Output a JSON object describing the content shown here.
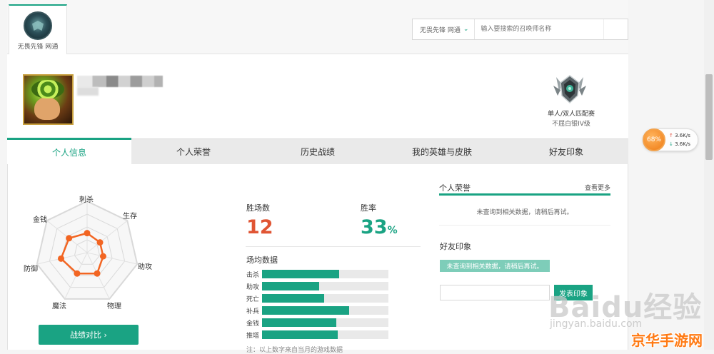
{
  "server": {
    "tab_label": "无畏先锋 网通",
    "select_label": "无畏先锋 网通"
  },
  "search": {
    "placeholder": "输入要搜索的召唤师名称"
  },
  "rank": {
    "queue": "单人/双人匹配赛",
    "tier": "不屈白银IV级"
  },
  "tabs": [
    {
      "label": "个人信息",
      "active": true
    },
    {
      "label": "个人荣誉",
      "active": false
    },
    {
      "label": "历史战绩",
      "active": false
    },
    {
      "label": "我的英雄与皮肤",
      "active": false
    },
    {
      "label": "好友印象",
      "active": false
    }
  ],
  "radar": {
    "axes": [
      "刺杀",
      "生存",
      "助攻",
      "物理",
      "魔法",
      "防御",
      "金钱"
    ],
    "values": [
      0.38,
      0.32,
      0.32,
      0.45,
      0.45,
      0.52,
      0.45
    ]
  },
  "compare_button": "战绩对比 ›",
  "stats": {
    "wins_label": "胜场数",
    "wins_value": "12",
    "winrate_label": "胜率",
    "winrate_value": "33",
    "winrate_unit": "%"
  },
  "avg": {
    "title": "场均数据",
    "rows": [
      {
        "label": "击杀",
        "fraction": 0.61
      },
      {
        "label": "助攻",
        "fraction": 0.45
      },
      {
        "label": "死亡",
        "fraction": 0.49
      },
      {
        "label": "补兵",
        "fraction": 0.69
      },
      {
        "label": "金钱",
        "fraction": 0.59
      },
      {
        "label": "推塔",
        "fraction": 0.6
      }
    ],
    "footnote": "注：以上数字来自当月的游戏数据"
  },
  "honor": {
    "title": "个人荣誉",
    "more": "查看更多",
    "empty": "未查询到相关数据，请稍后再试。"
  },
  "friend": {
    "title": "好友印象",
    "empty": "未查询到相关数据，请稍后再试。",
    "submit": "发表印象"
  },
  "speed": {
    "percent": "68%",
    "up": "3.6K/s",
    "down": "3.6K/s"
  },
  "watermark": {
    "baidu": "Baidu经验",
    "url": "jingyan.baidu.com",
    "site": "京华手游网"
  },
  "colors": {
    "accent": "#1aa383",
    "wins": "#e05534",
    "radar": "#f26522"
  }
}
